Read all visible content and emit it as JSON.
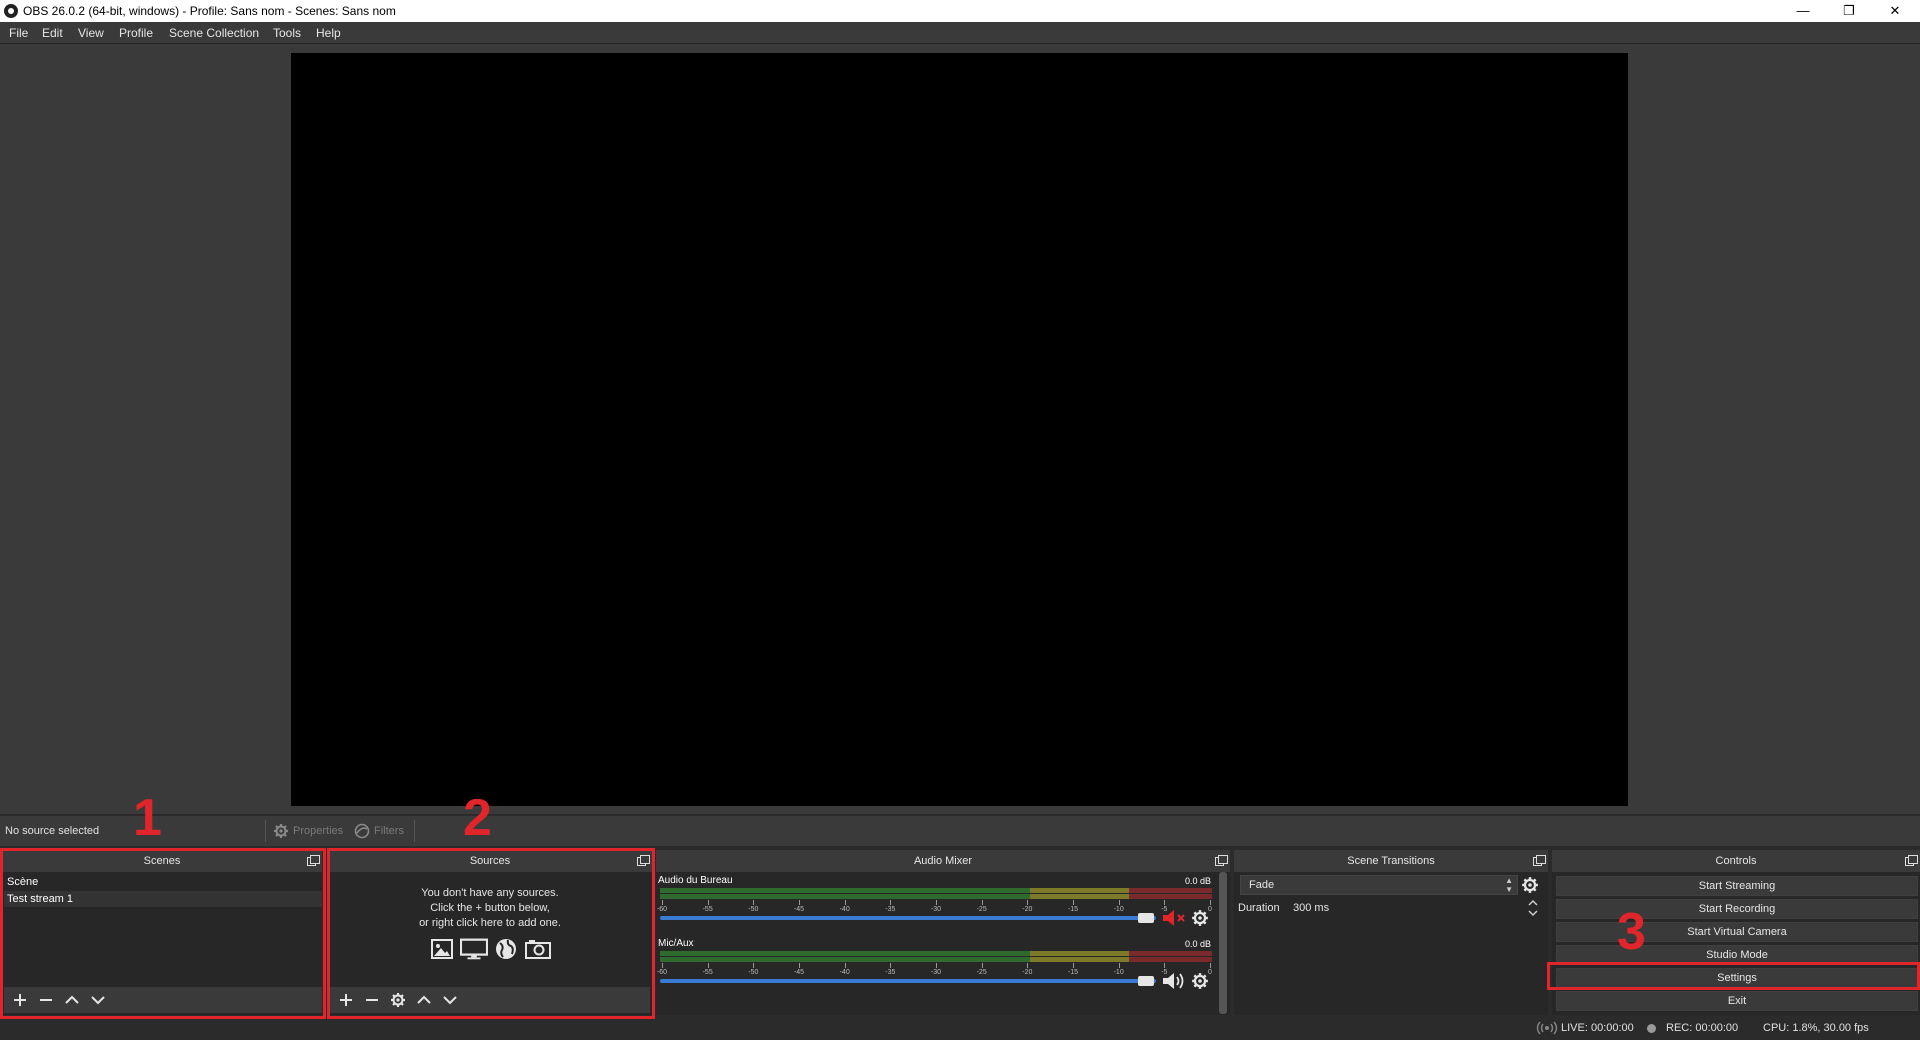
{
  "window": {
    "title": "OBS 26.0.2 (64-bit, windows) - Profile: Sans nom - Scenes: Sans nom",
    "minimize": "—",
    "restore": "❐",
    "close": "✕"
  },
  "menu": [
    "File",
    "Edit",
    "View",
    "Profile",
    "Scene Collection",
    "Tools",
    "Help"
  ],
  "context": {
    "no_source": "No source selected",
    "properties": "Properties",
    "filters": "Filters"
  },
  "scenes": {
    "title": "Scenes",
    "items": [
      "Scène",
      "Test stream 1"
    ]
  },
  "sources": {
    "title": "Sources",
    "empty_line1": "You don't have any sources.",
    "empty_line2": "Click the + button below,",
    "empty_line3": "or right click here to add one."
  },
  "audio_mixer": {
    "title": "Audio Mixer",
    "channels": [
      {
        "name": "Audio du Bureau",
        "db": "0.0 dB",
        "muted": true
      },
      {
        "name": "Mic/Aux",
        "db": "0.0 dB",
        "muted": false
      }
    ],
    "ticks": [
      "-60",
      "-55",
      "-50",
      "-45",
      "-40",
      "-35",
      "-30",
      "-25",
      "-20",
      "-15",
      "-10",
      "-5",
      "0"
    ]
  },
  "transitions": {
    "title": "Scene Transitions",
    "selected": "Fade",
    "duration_label": "Duration",
    "duration_value": "300 ms"
  },
  "controls": {
    "title": "Controls",
    "start_streaming": "Start Streaming",
    "start_recording": "Start Recording",
    "start_virtual_camera": "Start Virtual Camera",
    "studio_mode": "Studio Mode",
    "settings": "Settings",
    "exit": "Exit"
  },
  "status": {
    "live": "LIVE: 00:00:00",
    "rec": "REC: 00:00:00",
    "cpu": "CPU: 1.8%, 30.00 fps"
  },
  "annotations": [
    "1",
    "2",
    "3"
  ],
  "colors": {
    "annotation": "#e0252b",
    "fader": "#3a7bd5",
    "mute": "#e0252b"
  }
}
